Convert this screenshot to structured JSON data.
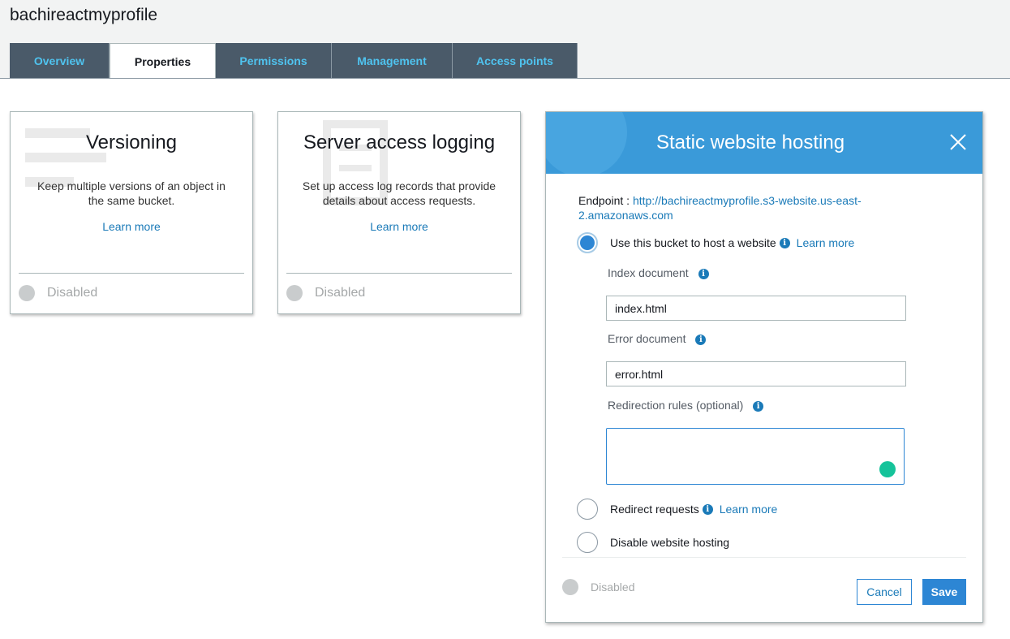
{
  "bucket": {
    "name": "bachireactmyprofile"
  },
  "tabs": [
    {
      "label": "Overview",
      "active": false
    },
    {
      "label": "Properties",
      "active": true
    },
    {
      "label": "Permissions",
      "active": false
    },
    {
      "label": "Management",
      "active": false
    },
    {
      "label": "Access points",
      "active": false
    }
  ],
  "cards": {
    "versioning": {
      "title": "Versioning",
      "description": "Keep multiple versions of an object in the same bucket.",
      "learn_more": "Learn more",
      "status": "Disabled"
    },
    "logging": {
      "title": "Server access logging",
      "description": "Set up access log records that provide details about access requests.",
      "learn_more": "Learn more",
      "status": "Disabled"
    }
  },
  "hosting": {
    "title": "Static website hosting",
    "endpoint_label": "Endpoint :",
    "endpoint_url": "http://bachireactmyprofile.s3-website.us-east-2.amazonaws.com",
    "options": {
      "host": {
        "label": "Use this bucket to host a website",
        "learn_more": "Learn more",
        "selected": true
      },
      "redirect": {
        "label": "Redirect requests",
        "learn_more": "Learn more",
        "selected": false
      },
      "disable": {
        "label": "Disable website hosting",
        "selected": false
      }
    },
    "index_label": "Index document",
    "index_value": "index.html",
    "error_label": "Error document",
    "error_value": "error.html",
    "redirection_label": "Redirection rules (optional)",
    "redirection_value": "",
    "status": "Disabled",
    "cancel_label": "Cancel",
    "save_label": "Save"
  },
  "colors": {
    "accent": "#2d86d4",
    "header_blue": "#3a9ad9",
    "tab_bg": "#4a5a69",
    "tab_text": "#4fc3ef",
    "link": "#1a7ab8",
    "disabled_dot": "#c9cccd"
  },
  "icons": {
    "info": "i",
    "close": "close-icon",
    "grammarly": "grammarly-icon"
  }
}
